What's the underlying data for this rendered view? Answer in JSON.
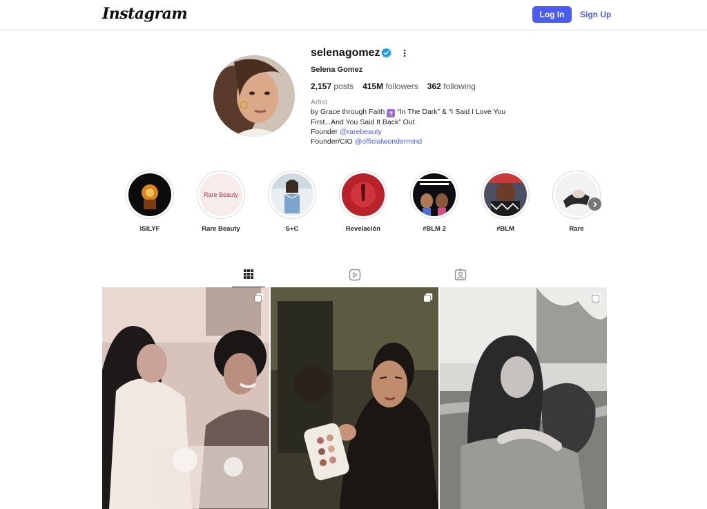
{
  "header": {
    "logo": "Instagram",
    "login_label": "Log In",
    "signup_label": "Sign Up"
  },
  "profile": {
    "username": "selenagomez",
    "verified": true,
    "full_name": "Selena Gomez",
    "stats": {
      "posts_count": "2,157",
      "posts_label": "posts",
      "followers_count": "415M",
      "followers_label": "followers",
      "following_count": "362",
      "following_label": "following"
    },
    "bio": {
      "category": "Artist",
      "line1_a": "by Grace through Faith",
      "line1_b": "“In The Dark” & “I Said I Love You",
      "line2": "First...And You Said It Back” Out",
      "founder_prefix": "Founder",
      "founder_link": "@rarebeauty",
      "cio_prefix": "Founder/CIO",
      "cio_link": "@officialwondermind"
    }
  },
  "highlights": [
    {
      "label": "ISILYF"
    },
    {
      "label": "Rare Beauty",
      "inner_text": "Rare Beauty"
    },
    {
      "label": "S+C"
    },
    {
      "label": "Revelación"
    },
    {
      "label": "#BLM 2"
    },
    {
      "label": "#BLM"
    },
    {
      "label": "Rare"
    }
  ],
  "tabs": [
    {
      "icon": "grid-icon",
      "active": true
    },
    {
      "icon": "reels-icon",
      "active": false
    },
    {
      "icon": "tagged-icon",
      "active": false
    }
  ],
  "posts": [
    {
      "type": "carousel"
    },
    {
      "type": "carousel"
    },
    {
      "type": "carousel"
    }
  ],
  "colors": {
    "accent": "#4a5df0",
    "verified": "#1d9bf0",
    "border": "#dbdbdb"
  }
}
